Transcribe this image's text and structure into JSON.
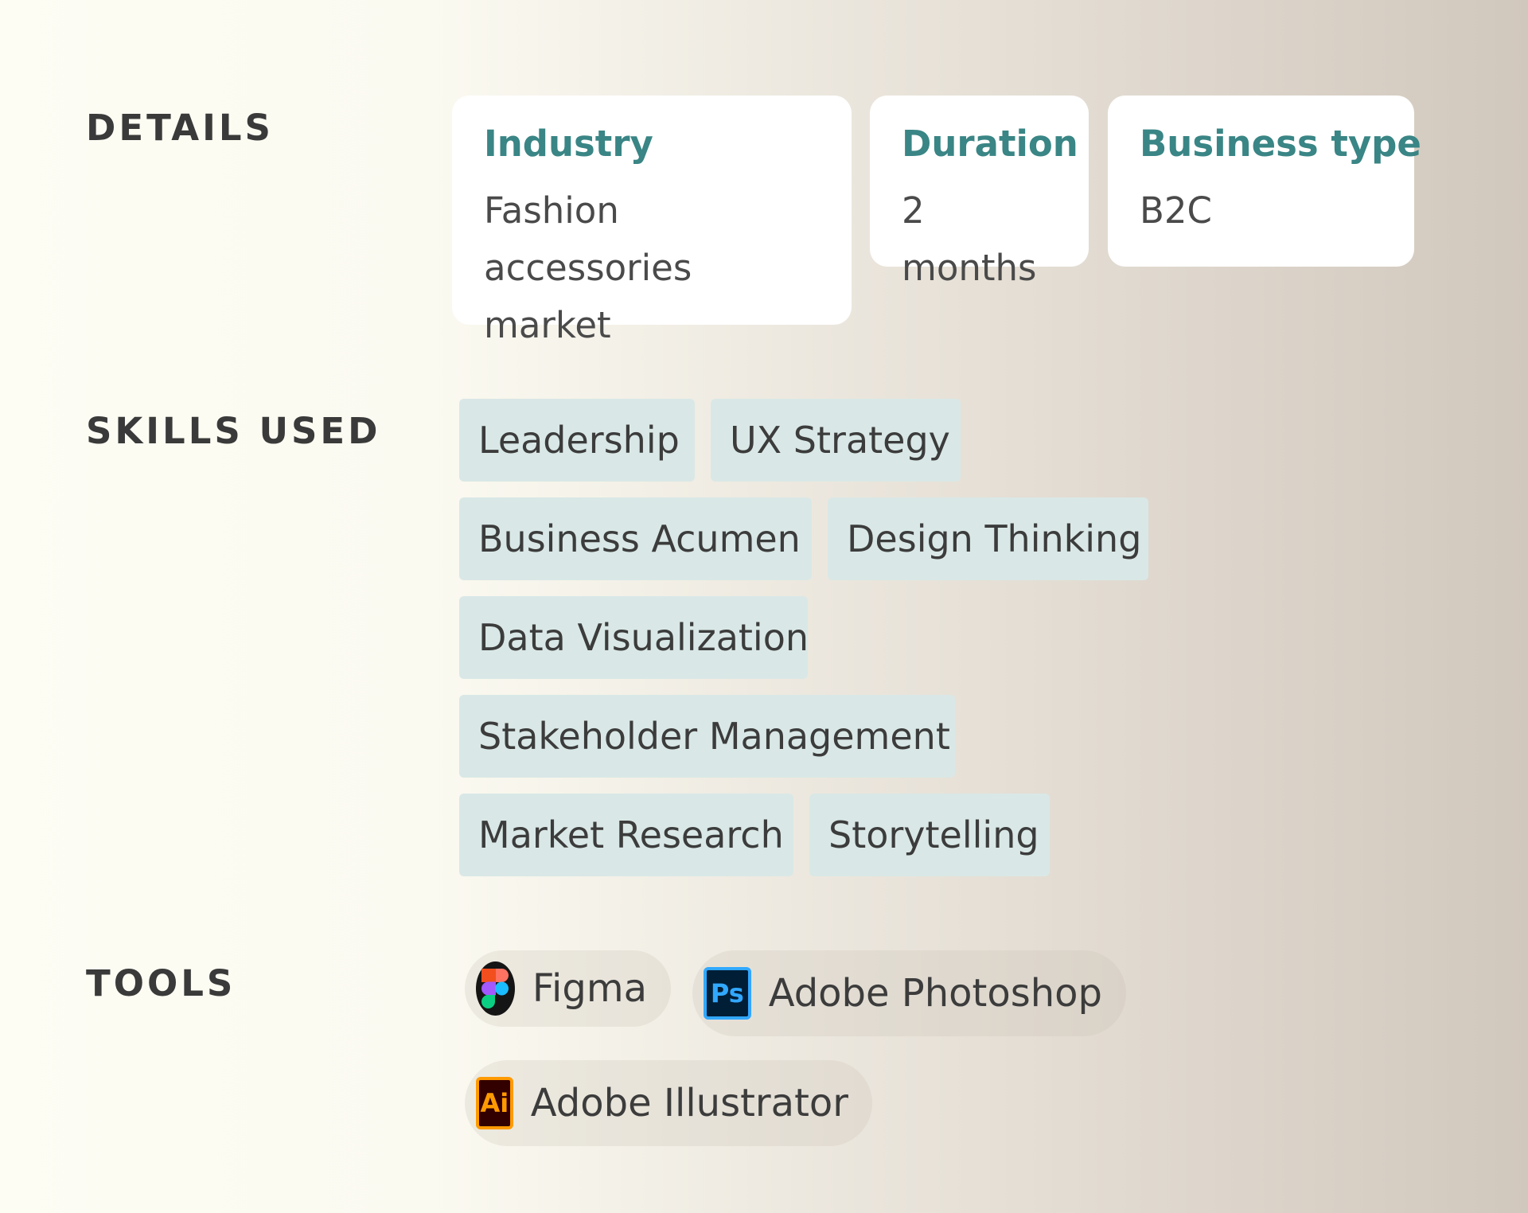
{
  "details": {
    "heading": "DETAILS",
    "cards": [
      {
        "title": "Industry",
        "value_line1": "Fashion",
        "value_line2": "accessories market"
      },
      {
        "title": "Duration",
        "value": "2 months"
      },
      {
        "title": "Business type",
        "value": "B2C"
      }
    ]
  },
  "skills": {
    "heading": "SKILLS USED",
    "items": [
      "Leadership",
      "UX Strategy",
      "Business Acumen",
      "Design Thinking",
      "Data Visualization",
      "Stakeholder Management",
      "Market Research",
      "Storytelling"
    ]
  },
  "tools": {
    "heading": "TOOLS",
    "items": [
      {
        "label": "Figma",
        "icon": "figma-icon"
      },
      {
        "label": "Adobe Photoshop",
        "icon": "photoshop-icon",
        "icon_text": "Ps"
      },
      {
        "label": "Adobe Illustrator",
        "icon": "illustrator-icon",
        "icon_text": "Ai"
      }
    ]
  },
  "colors": {
    "accent": "#3a8585",
    "chip_bg": "#d9e8e6",
    "text": "#3c3c3c"
  }
}
